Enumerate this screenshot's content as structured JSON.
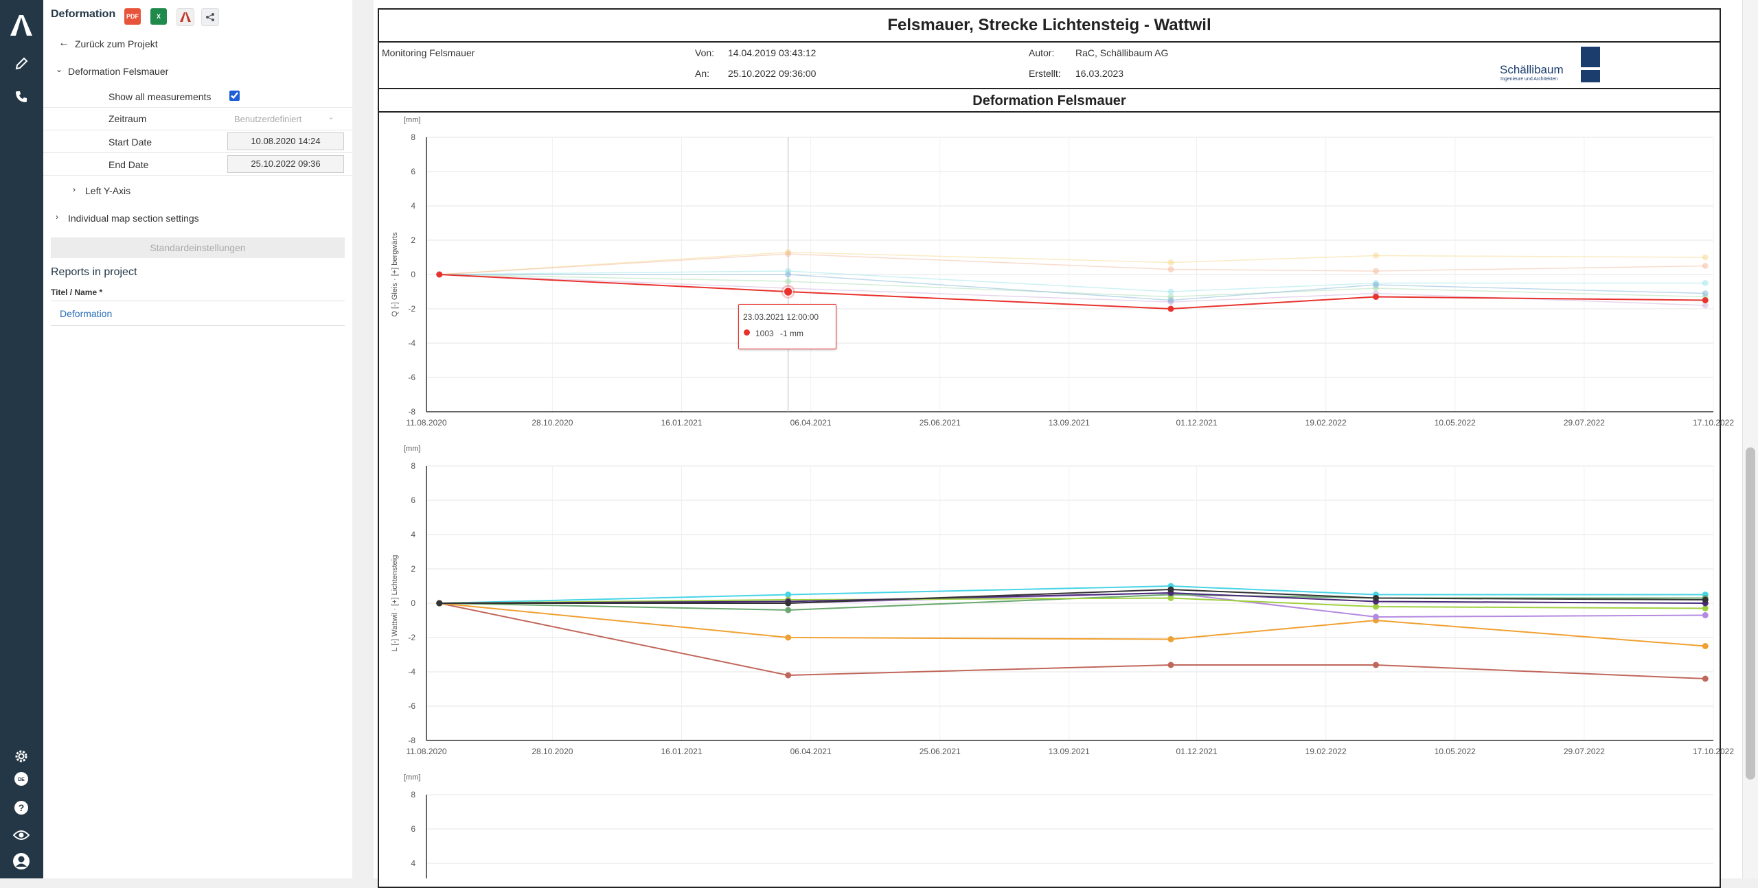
{
  "left_panel": {
    "report_name": "Deformation",
    "export_icons": [
      "pdf-icon",
      "excel-icon",
      "acrobat-icon",
      "share-icon"
    ],
    "pdf_label": "PDF",
    "excel_label": "X",
    "back_label": "Zurück zum Projekt",
    "section_label": "Deformation Felsmauer",
    "show_all_label": "Show all measurements",
    "show_all_checked": true,
    "zeitraum_label": "Zeitraum",
    "zeitraum_value": "Benutzerdefiniert",
    "start_label": "Start Date",
    "start_value": "10.08.2020 14:24",
    "end_label": "End Date",
    "end_value": "25.10.2022 09:36",
    "left_axis_label": "Left Y-Axis",
    "individual_label": "Individual map section settings",
    "default_button": "Standardeinstellungen",
    "reports_heading": "Reports in project",
    "col_header": "Titel / Name *",
    "report_link": "Deformation"
  },
  "rail": {
    "icons": [
      "app-logo-icon",
      "edit-icon",
      "phone-icon",
      "settings-icon",
      "language-icon",
      "help-icon",
      "eye-icon",
      "user-icon"
    ],
    "language_label": "DE"
  },
  "report": {
    "title": "Felsmauer, Strecke Lichtensteig - Wattwil",
    "project": "Monitoring Felsmauer",
    "von_label": "Von:",
    "von_value": "14.04.2019 03:43:12",
    "an_label": "An:",
    "an_value": "25.10.2022 09:36:00",
    "autor_label": "Autor:",
    "autor_value": "RaC, Schällibaum AG",
    "erstellt_label": "Erstellt:",
    "erstellt_value": "16.03.2023",
    "logo_text": "Schällibaum",
    "logo_subtext": "Ingenieure und Architekten",
    "section_title": "Deformation Felsmauer"
  },
  "tooltip": {
    "date": "23.03.2021 12:00:00",
    "series": "1003",
    "value": "-1 mm",
    "color": "#e8322d"
  },
  "chart_data": [
    {
      "type": "line",
      "unit_label": "[mm]",
      "ylabel": "Q [-] Gleis · [+] bergwärts",
      "ylim": [
        -8,
        8
      ],
      "yticks": [
        -8,
        -6,
        -4,
        -2,
        0,
        2,
        4,
        6,
        8
      ],
      "xticks": [
        "11.08.2020",
        "28.10.2020",
        "16.01.2021",
        "06.04.2021",
        "25.06.2021",
        "13.09.2021",
        "01.12.2021",
        "19.02.2022",
        "10.05.2022",
        "29.07.2022",
        "17.10.2022"
      ],
      "grid": true,
      "crosshair_x": "23.03.2021",
      "x": [
        "19.08.2020",
        "23.03.2021",
        "15.11.2021",
        "22.03.2022",
        "12.10.2022"
      ],
      "series": [
        {
          "color": "#e8322d",
          "opacity": 1,
          "values": [
            0,
            -1,
            -2,
            -1.3,
            -1.5
          ]
        },
        {
          "color": "#f4b79a",
          "opacity": 0.5,
          "values": [
            0,
            1.2,
            0.3,
            0.2,
            0.5
          ]
        },
        {
          "color": "#f2d27a",
          "opacity": 0.45,
          "values": [
            0,
            1.3,
            0.7,
            1.1,
            1.0
          ]
        },
        {
          "color": "#7db3d8",
          "opacity": 0.5,
          "values": [
            0,
            0,
            -1.5,
            -0.6,
            -1.1
          ]
        },
        {
          "color": "#9ed8a6",
          "opacity": 0.45,
          "values": [
            0,
            -0.4,
            -1.3,
            -0.8,
            -1.3
          ]
        },
        {
          "color": "#c7a3d8",
          "opacity": 0.45,
          "values": [
            0,
            -0.8,
            -1.6,
            -1.1,
            -1.8
          ]
        },
        {
          "color": "#8fe0e6",
          "opacity": 0.45,
          "values": [
            0,
            0.2,
            -1.0,
            -0.5,
            -0.5
          ]
        }
      ]
    },
    {
      "type": "line",
      "unit_label": "[mm]",
      "ylabel": "L [-] Wattwil · [+] Lichtensteig",
      "ylim": [
        -8,
        8
      ],
      "yticks": [
        -8,
        -6,
        -4,
        -2,
        0,
        2,
        4,
        6,
        8
      ],
      "xticks": [
        "11.08.2020",
        "28.10.2020",
        "16.01.2021",
        "06.04.2021",
        "25.06.2021",
        "13.09.2021",
        "01.12.2021",
        "19.02.2022",
        "10.05.2022",
        "29.07.2022",
        "17.10.2022"
      ],
      "grid": true,
      "x": [
        "19.08.2020",
        "23.03.2021",
        "15.11.2021",
        "22.03.2022",
        "12.10.2022"
      ],
      "series": [
        {
          "color": "#c0665a",
          "opacity": 1,
          "values": [
            0,
            -4.2,
            -3.6,
            -3.6,
            -4.4
          ]
        },
        {
          "color": "#f0a030",
          "opacity": 1,
          "values": [
            0,
            -2.0,
            -2.1,
            -1.0,
            -2.5
          ]
        },
        {
          "color": "#b48ae0",
          "opacity": 1,
          "values": [
            0,
            0,
            0.6,
            -0.8,
            -0.7
          ]
        },
        {
          "color": "#46d4e6",
          "opacity": 1,
          "values": [
            0,
            0.5,
            1.0,
            0.5,
            0.5
          ]
        },
        {
          "color": "#6aa870",
          "opacity": 1,
          "values": [
            0,
            -0.4,
            0.5,
            0.3,
            0.3
          ]
        },
        {
          "color": "#a0d040",
          "opacity": 1,
          "values": [
            0,
            0.2,
            0.3,
            -0.2,
            -0.3
          ]
        },
        {
          "color": "#4b2a7a",
          "opacity": 1,
          "values": [
            0,
            0.1,
            0.6,
            0.1,
            0
          ]
        },
        {
          "color": "#333333",
          "opacity": 1,
          "values": [
            0,
            0,
            0.8,
            0.3,
            0.2
          ]
        }
      ]
    },
    {
      "type": "line",
      "unit_label": "[mm]",
      "ylim": [
        -8,
        8
      ],
      "yticks": [
        4,
        6,
        8
      ],
      "grid": true,
      "series": []
    }
  ]
}
